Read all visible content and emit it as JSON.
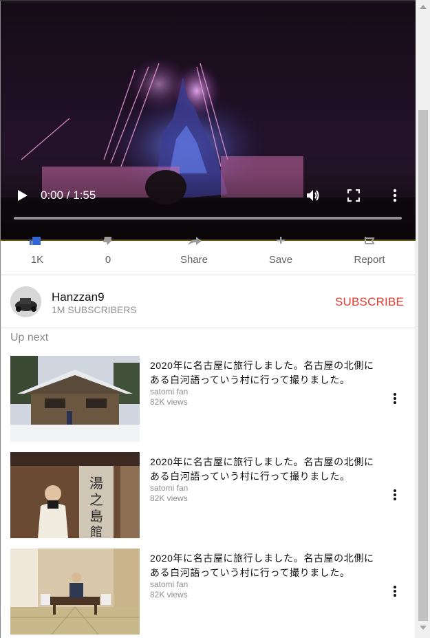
{
  "player": {
    "time_display": "0:00 / 1:55",
    "progress_fraction": 0.0
  },
  "actions": {
    "like_label": "1K",
    "dislike_label": "0",
    "share_label": "Share",
    "save_label": "Save",
    "report_label": "Report"
  },
  "channel": {
    "name": "Hanzzan9",
    "subscribers": "1M SUBSCRIBERS",
    "subscribe_label": "SUBSCRIBE"
  },
  "up_next": {
    "heading": "Up next",
    "items": [
      {
        "title": "2020年に名古屋に旅行しました。名古屋の北側にある白河語っていう村に行って撮りました。",
        "channel": "satomi fan",
        "views": "82K views"
      },
      {
        "title": "2020年に名古屋に旅行しました。名古屋の北側にある白河語っていう村に行って撮りました。",
        "channel": "satomi fan",
        "views": "82K views"
      },
      {
        "title": "2020年に名古屋に旅行しました。名古屋の北側にある白河語っていう村に行って撮りました。",
        "channel": "satomi fan",
        "views": "82K views"
      }
    ]
  },
  "colors": {
    "subscribe": "#e33b2e",
    "like_blue": "#3166d4",
    "muted_text": "#909090"
  }
}
